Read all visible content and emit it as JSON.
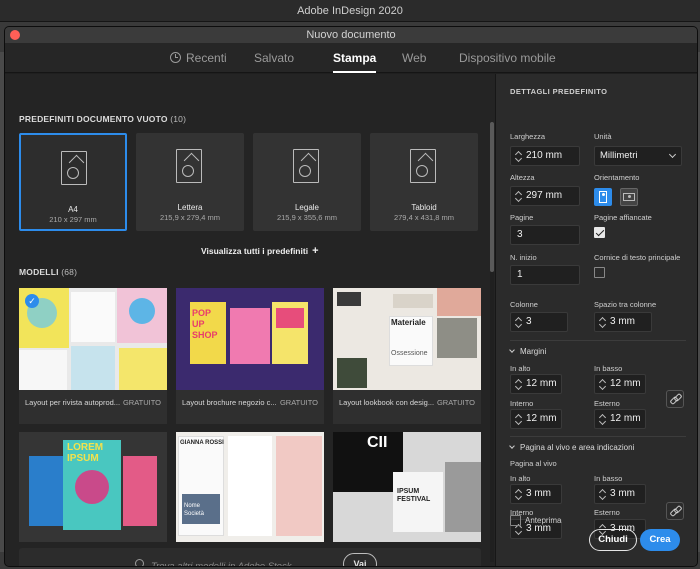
{
  "app": {
    "title": "Adobe InDesign 2020"
  },
  "dialog": {
    "title": "Nuovo documento"
  },
  "tabs": [
    {
      "label": "Recenti",
      "icon": "clock-icon"
    },
    {
      "label": "Salvato"
    },
    {
      "label": "Stampa",
      "active": true
    },
    {
      "label": "Web"
    },
    {
      "label": "Dispositivo mobile"
    }
  ],
  "presets_section": {
    "title": "PREDEFINITI DOCUMENTO VUOTO",
    "count": "(10)"
  },
  "presets": [
    {
      "name": "A4",
      "size": "210 x 297 mm",
      "selected": true
    },
    {
      "name": "Lettera",
      "size": "215,9 x 279,4 mm"
    },
    {
      "name": "Legale",
      "size": "215,9 x 355,6 mm"
    },
    {
      "name": "Tabloid",
      "size": "279,4 x 431,8 mm"
    }
  ],
  "view_all": "Visualizza tutti i predefiniti",
  "templates_section": {
    "title": "MODELLI",
    "count": "(68)"
  },
  "templates": [
    {
      "name": "Layout per rivista autoprod...",
      "badge": "GRATUITO"
    },
    {
      "name": "Layout brochure negozio c...",
      "badge": "GRATUITO",
      "text": [
        "POP",
        "UP",
        "SHOP"
      ]
    },
    {
      "name": "Layout lookbook con desig...",
      "badge": "GRATUITO",
      "text": [
        "Materiale",
        "Ossessione"
      ]
    },
    {
      "name": "",
      "badge": "",
      "text": [
        "LOREM",
        "IPSUM"
      ]
    },
    {
      "name": "",
      "badge": "",
      "text": [
        "GIANNA ROSSI",
        "Nome",
        "Società"
      ]
    },
    {
      "name": "",
      "badge": "",
      "text": [
        "IPSUM",
        "FESTIVAL"
      ]
    }
  ],
  "search": {
    "placeholder": "Trova altri modelli in Adobe Stock",
    "button": "Vai"
  },
  "details": {
    "header": "DETTAGLI PREDEFINITO",
    "width_label": "Larghezza",
    "width": "210 mm",
    "units_label": "Unità",
    "units": "Millimetri",
    "height_label": "Altezza",
    "height": "297 mm",
    "orientation_label": "Orientamento",
    "pages_label": "Pagine",
    "pages": "3",
    "facing_label": "Pagine affiancate",
    "facing_checked": true,
    "start_label": "N. inizio",
    "start": "1",
    "primary_frame_label": "Cornice di testo principale",
    "primary_frame_checked": false,
    "columns_label": "Colonne",
    "columns": "3",
    "gutter_label": "Spazio tra colonne",
    "gutter": "3 mm",
    "margins": {
      "title": "Margini",
      "top_label": "In alto",
      "top": "12 mm",
      "bottom_label": "In basso",
      "bottom": "12 mm",
      "inside_label": "Interno",
      "inside": "12 mm",
      "outside_label": "Esterno",
      "outside": "12 mm"
    },
    "bleed": {
      "title": "Pagina al vivo e area indicazioni",
      "subtitle": "Pagina al vivo",
      "top_label": "In alto",
      "top": "3 mm",
      "bottom_label": "In basso",
      "bottom": "3 mm",
      "inside_label": "Interno",
      "inside": "3 mm",
      "outside_label": "Esterno",
      "outside": "3 mm"
    }
  },
  "footer": {
    "preview_label": "Anteprima",
    "close": "Chiudi",
    "create": "Crea"
  },
  "colors": {
    "accent": "#2d8ceb",
    "panel": "#2b2b2b",
    "content": "#242424"
  }
}
